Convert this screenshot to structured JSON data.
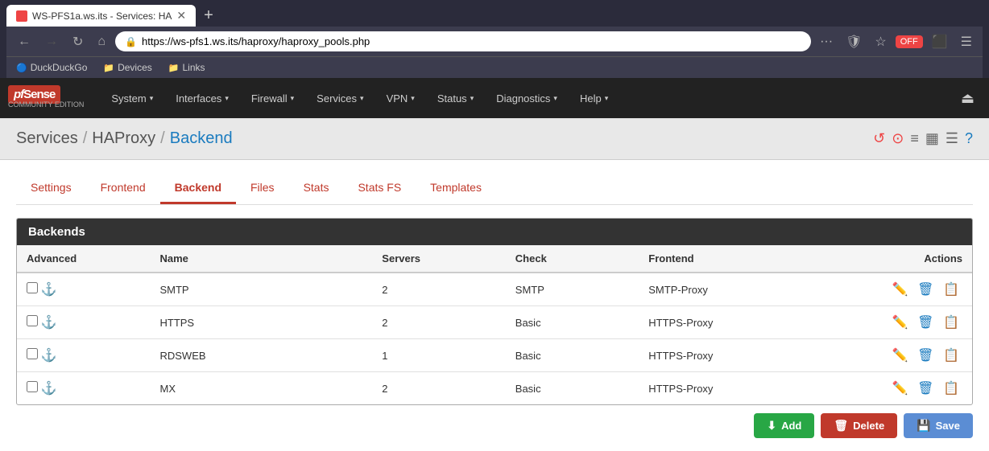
{
  "browser": {
    "tab_title": "WS-PFS1a.ws.its - Services: HA",
    "url": "https://ws-pfs1.ws.its/haproxy/haproxy_pools.php",
    "bookmarks": [
      {
        "label": "DuckDuckGo",
        "icon": "🦆"
      },
      {
        "label": "Devices",
        "icon": "📁"
      },
      {
        "label": "Links",
        "icon": "📁"
      }
    ]
  },
  "navbar": {
    "brand": "pfSense",
    "edition": "COMMUNITY EDITION",
    "menu_items": [
      {
        "label": "System",
        "has_dropdown": true
      },
      {
        "label": "Interfaces",
        "has_dropdown": true
      },
      {
        "label": "Firewall",
        "has_dropdown": true
      },
      {
        "label": "Services",
        "has_dropdown": true
      },
      {
        "label": "VPN",
        "has_dropdown": true
      },
      {
        "label": "Status",
        "has_dropdown": true
      },
      {
        "label": "Diagnostics",
        "has_dropdown": true
      },
      {
        "label": "Help",
        "has_dropdown": true
      }
    ],
    "logout_icon": "⏏"
  },
  "breadcrumb": {
    "parts": [
      "Services",
      "HAProxy",
      "Backend"
    ],
    "separators": [
      "/",
      "/"
    ]
  },
  "breadcrumb_actions": {
    "icons": [
      "↺",
      "⊙",
      "≡",
      "▦",
      "☰",
      "?"
    ]
  },
  "page_title": "Backend",
  "tabs": [
    {
      "label": "Settings",
      "active": false
    },
    {
      "label": "Frontend",
      "active": false
    },
    {
      "label": "Backend",
      "active": true
    },
    {
      "label": "Files",
      "active": false
    },
    {
      "label": "Stats",
      "active": false
    },
    {
      "label": "Stats FS",
      "active": false
    },
    {
      "label": "Templates",
      "active": false
    }
  ],
  "table": {
    "section_title": "Backends",
    "columns": [
      {
        "label": "Advanced"
      },
      {
        "label": "Name"
      },
      {
        "label": "Servers"
      },
      {
        "label": "Check"
      },
      {
        "label": "Frontend"
      },
      {
        "label": "Actions"
      }
    ],
    "rows": [
      {
        "name": "SMTP",
        "servers": "2",
        "check": "SMTP",
        "frontend": "SMTP-Proxy"
      },
      {
        "name": "HTTPS",
        "servers": "2",
        "check": "Basic",
        "frontend": "HTTPS-Proxy"
      },
      {
        "name": "RDSWEB",
        "servers": "1",
        "check": "Basic",
        "frontend": "HTTPS-Proxy"
      },
      {
        "name": "MX",
        "servers": "2",
        "check": "Basic",
        "frontend": "HTTPS-Proxy"
      }
    ]
  },
  "buttons": {
    "add": "Add",
    "delete": "Delete",
    "save": "Save"
  }
}
